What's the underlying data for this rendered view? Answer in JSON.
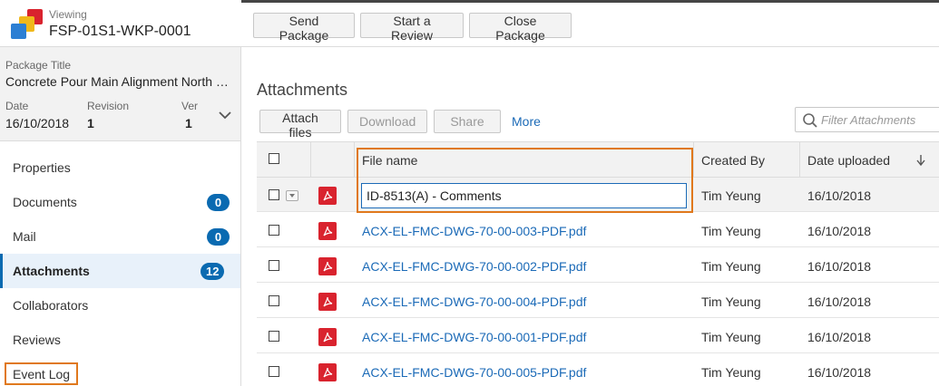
{
  "header": {
    "viewing_label": "Viewing",
    "package_number": "FSP-01S1-WKP-0001",
    "buttons": {
      "send_package": "Send Package",
      "start_review": "Start a Review",
      "close_package": "Close Package"
    }
  },
  "summary": {
    "title_label": "Package Title",
    "title_value": "Concrete Pour Main Alignment North …",
    "date_label": "Date",
    "date_value": "16/10/2018",
    "revision_label": "Revision",
    "revision_value": "1",
    "ver_label": "Ver",
    "ver_value": "1"
  },
  "nav": {
    "properties": "Properties",
    "documents": "Documents",
    "documents_count": "0",
    "mail": "Mail",
    "mail_count": "0",
    "attachments": "Attachments",
    "attachments_count": "12",
    "collaborators": "Collaborators",
    "reviews": "Reviews",
    "event_log": "Event Log"
  },
  "main": {
    "section_title": "Attachments",
    "toolbar": {
      "attach": "Attach files",
      "download": "Download",
      "share": "Share",
      "more": "More"
    },
    "filter_placeholder": "Filter Attachments"
  },
  "table": {
    "columns": {
      "file_name": "File name",
      "created_by": "Created By",
      "date_uploaded": "Date uploaded"
    },
    "editing_value": "ID-8513(A) - Comments",
    "rows": [
      {
        "file": "",
        "created_by": "Tim Yeung",
        "date": "16/10/2018"
      },
      {
        "file": "ACX-EL-FMC-DWG-70-00-003-PDF.pdf",
        "created_by": "Tim Yeung",
        "date": "16/10/2018"
      },
      {
        "file": "ACX-EL-FMC-DWG-70-00-002-PDF.pdf",
        "created_by": "Tim Yeung",
        "date": "16/10/2018"
      },
      {
        "file": "ACX-EL-FMC-DWG-70-00-004-PDF.pdf",
        "created_by": "Tim Yeung",
        "date": "16/10/2018"
      },
      {
        "file": "ACX-EL-FMC-DWG-70-00-001-PDF.pdf",
        "created_by": "Tim Yeung",
        "date": "16/10/2018"
      },
      {
        "file": "ACX-EL-FMC-DWG-70-00-005-PDF.pdf",
        "created_by": "Tim Yeung",
        "date": "16/10/2018"
      }
    ]
  },
  "colors": {
    "accent": "#0a6ab1",
    "link": "#1b6ab7",
    "highlight": "#e0781c",
    "pdf": "#d9232e"
  },
  "icons": [
    "app-logo-icon",
    "chevron-down-icon",
    "search-icon",
    "pdf-file-icon",
    "sort-down-icon",
    "dropdown-caret-icon"
  ]
}
